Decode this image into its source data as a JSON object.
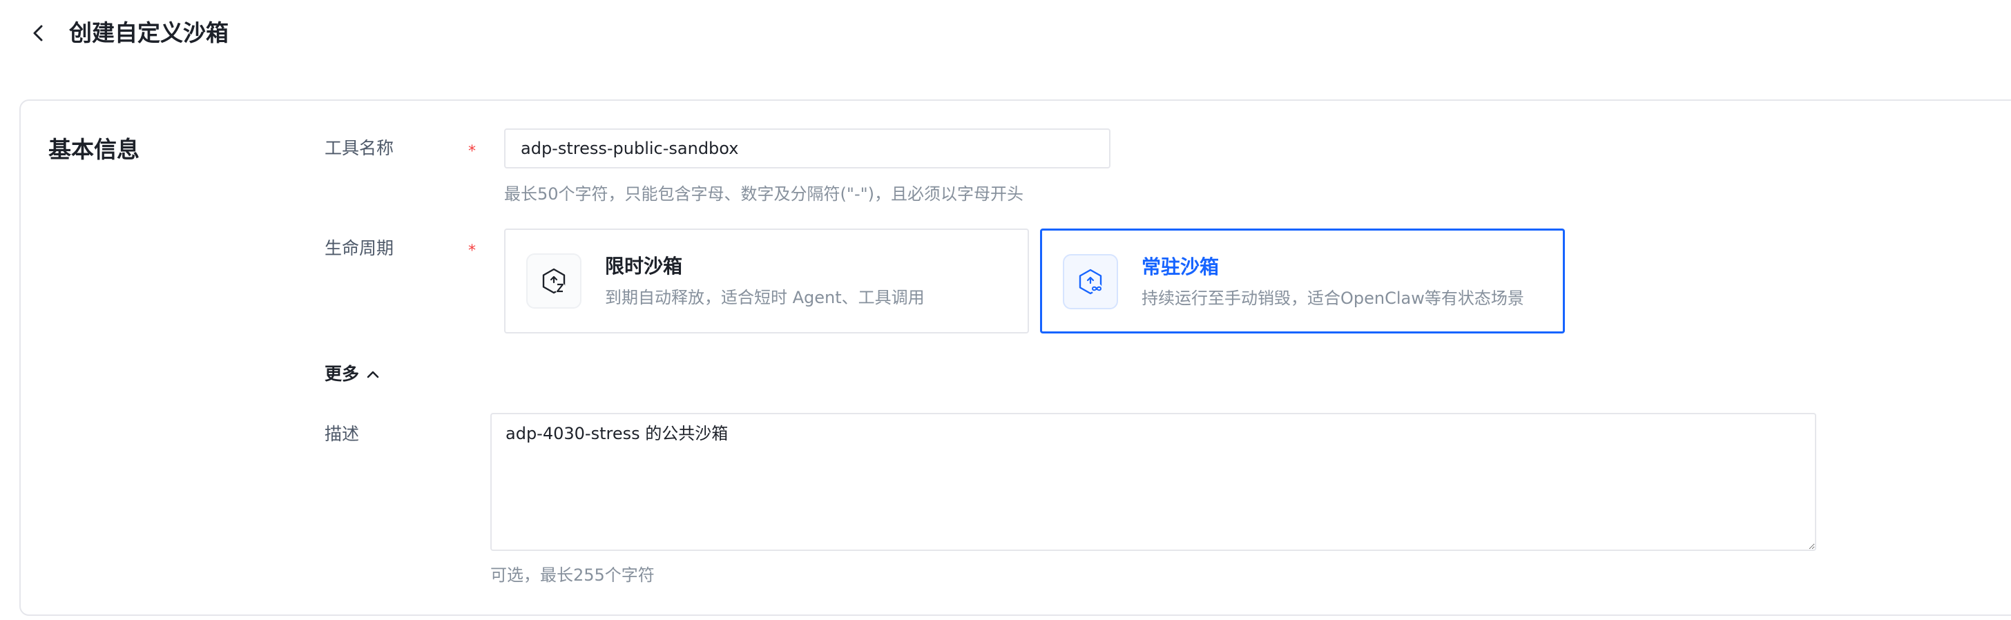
{
  "header": {
    "title": "创建自定义沙箱",
    "back_icon": "chevron-left-icon"
  },
  "section": {
    "title": "基本信息"
  },
  "form": {
    "name": {
      "label": "工具名称",
      "required_mark": "*",
      "value": "adp-stress-public-sandbox",
      "hint": "最长50个字符，只能包含字母、数字及分隔符(\"-\")，且必须以字母开头"
    },
    "lifecycle": {
      "label": "生命周期",
      "required_mark": "*",
      "options": [
        {
          "title": "限时沙箱",
          "desc": "到期自动释放，适合短时 Agent、工具调用",
          "icon": "timed-sandbox-icon",
          "selected": false
        },
        {
          "title": "常驻沙箱",
          "desc": "持续运行至手动销毁，适合OpenClaw等有状态场景",
          "icon": "persistent-sandbox-icon",
          "selected": true
        }
      ]
    },
    "more": {
      "label": "更多",
      "icon": "chevron-up-icon",
      "expanded": true
    },
    "description": {
      "label": "描述",
      "value": "adp-4030-stress 的公共沙箱",
      "hint": "可选，最长255个字符"
    }
  },
  "colors": {
    "accent": "#1664ff",
    "required": "#f53f3f",
    "border": "#e5e6eb",
    "muted_text": "#86909c",
    "label_text": "#4e5969"
  }
}
